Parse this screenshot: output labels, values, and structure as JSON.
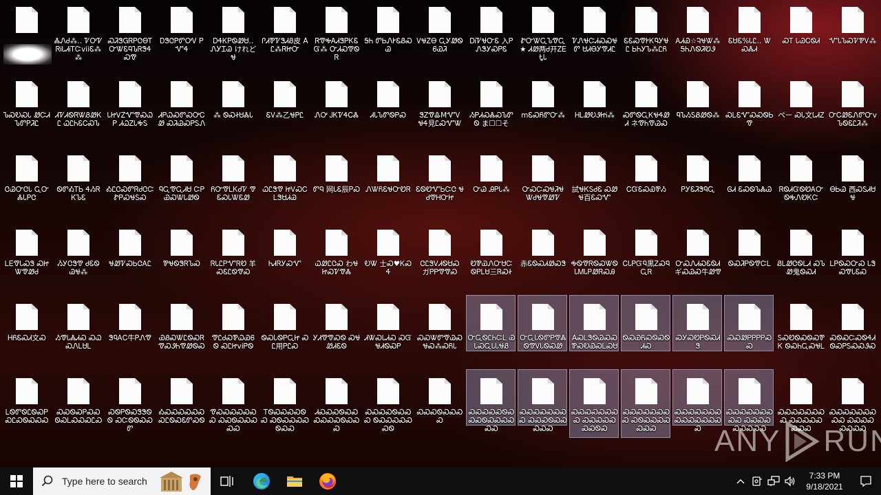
{
  "desktop": {
    "icons": [
      {
        "label": ""
      },
      {
        "label": "ᏜᏁᏧ⁂‥ ᏤᎤᏤᏒᎥᏓᏗᎥᎢᏨviiᏋ⁂⁂"
      },
      {
        "label": "ᏍᏘᏕᏀᏒᏢᏣᎾᎢᏅᏔᏋᏄᏖᏒᏕᏎᏍᏡ"
      },
      {
        "label": "ᎠᏕᏣᏢᏛᎤᏙ ᏢᏉᏎ"
      },
      {
        "label": "ᎠᏎᏦᏢᏫᏪᏌ‥ ᏁᎩᏆᏊ けれどᏠ"
      },
      {
        "label": "ᎵᏗᏈᏤᏕᏗᏰ皮 ÀᏝ⁂ᏒᏥᏅ"
      },
      {
        "label": "ᏒᏡᎭᎪᏗᏕᏢᏦᏋᏳ⁂ ᏅᏗᏍᏡᏫᏒ"
      },
      {
        "label": "ᎦᏂ ᏛᏏᏁᎨᏋᏰᏍᏊ"
      },
      {
        "label": "ᏙᏠᏃᎾ ᏩᎩᏪᏫᏮᏯᏘ"
      },
      {
        "label": "ᎠᎥᏤᏠᏅᏋ 入ᏢᏁᏕᎩᏍᏢᏋ"
      },
      {
        "label": "ᏑᏅᏔᏩᏖᏡᏩ★ ᏗᏪ两Ꮷ开ᏃᎬᎿᏓ"
      },
      {
        "label": "ᏤᏁᏠᏨᏗᏍᏍᏠᏛ ᏌᏗᎾᎩᏡᏗᏝ"
      },
      {
        "label": "ᏋᏋᏍᏡᎨᏦᏄᎩᏠᏝ ᏏᏂᎩᏖ⁂ᏝᏲ"
      },
      {
        "label": "ᎪᏗᏯ☆ᎸᏠᏔ⁂ ᎦᏂᏁᏫᏘᏬᏭ"
      },
      {
        "label": "ᏋᏌᏋ%ᏓᏝ‥ ᏔᏍᏜᏗ"
      },
      {
        "label": "ᏍᎢ ᏓᏊᏟᏫᏗ"
      },
      {
        "label": "ᏉᏓᏖᏍᏤᏈᏙ⁂"
      },
      {
        "label": "ᏖᏍᎧᏍᏓ ᏪᏨᏗᏖᏛᏢᏘᏝ"
      },
      {
        "label": "ᏗᏤᏗᏫᏒᏔᏰᏪᏦᏝ ᏇᏝᏂᏋᏟᏍᏖ"
      },
      {
        "label": "ᏓᏥᏙᏃᏉᏡᏍᏇᏢ ᏗᏇᏃᏓᎭᏚ"
      },
      {
        "label": "ᏗᏢᏇᏍᏛᏍᎤᏟᏪ ᏍᏘᏊᏍᏢᏚᏁ"
      },
      {
        "label": "⁂ ᏫᏍᏐᏌᏜᏓ"
      },
      {
        "label": "ᏋᏙ⁂乙ᏠᏢᏝ"
      },
      {
        "label": "ᏁᎤ ᎫᏦᏤᏎᏟᏜ"
      },
      {
        "label": "ᏗᏓᏖᏛᏫᏢᏍ"
      },
      {
        "label": "ᏕᏃᏡᎲMᏉᏙ ᏠᏎ見ᏝᏍᏉᏔ"
      },
      {
        "label": "ᏱᏢᏗᏍᏜᏍᏖᏛᏫ ま☐☐そ"
      },
      {
        "label": "mᏋᏍᏲᏛᏅ⁂"
      },
      {
        "label": "ᎻᏞᏪᎧᏭᏥᎥ⁂"
      },
      {
        "label": "ᏍᏛᏫᏩᏦᏠᏎᏪᏗ ネᏡᏂᏡᏊᏍ"
      },
      {
        "label": "ᏄᏖᏱᏚᏰᏪᏫ⁂"
      },
      {
        "label": "ᏍᏞᏋᏉᏍᏍᏫᏏᏡ"
      },
      {
        "label": "ペー ᏍᏓ文ᏓᏗᏃ"
      },
      {
        "label": "ᏅᏟᏪᏋᏁᏛᏅv ᏖᏫᏋᏝᏘ⁂"
      },
      {
        "label": "ᏣᏊᏅᏣᏓ ᏩᏅᏜᏓᏢᏣ"
      },
      {
        "label": "ᏫᏛᎣᎢᏏ ᏎᏱᏒᏦᏖᏋ"
      },
      {
        "label": "ᎣᏝᏣᏍᏛᏒᏧᏣᏨ ᏑᏢᏍᏠᏚᏍ"
      },
      {
        "label": "ᏄᏩᏡᏩᏗᏌ ᏨᏢᏯᏍᏔᏓᏪᏫ"
      },
      {
        "label": "ᏲᏅᏡᏞᏦᏧᏤ ᏡᏋᏍᏓᏔᏋᏪ"
      },
      {
        "label": "ᏇᏝᏕᏡ ᏥᏙᏍᏟᏞᏕᏌᏗᏊ"
      },
      {
        "label": "ᏛᏄ 网ᏓᏋ辰ᏢᏍ"
      },
      {
        "label": "ᏁᏔᏲᏋᏠᏅᏬᏒ"
      },
      {
        "label": "ᏋᏫᏬᏉᏏᏨᏣ ᏠᏧᏡᎻᏅᏥ"
      },
      {
        "label": "ᏅᏊ ᎯᏢᏓ⁂"
      },
      {
        "label": "ᏅᏍᏨᏍᏠᏘᏠ ᏔᏧᏠᏡᏪᏤ"
      },
      {
        "label": "試ᏠᏦᏚᏧᏋ ᏍᏪᏠ百ᏋᏍᏉ"
      },
      {
        "label": "ᏟᏳᏋᏍᏯᏈᏱ"
      },
      {
        "label": "ᏢᎩᏋᏘᏕᏄᏩ"
      },
      {
        "label": "ᎶᏗ ᏋᏍᏫᏖᏜᏊ"
      },
      {
        "label": "ᏒᏫᏗᏳᏫᏬᎪᏅ ᏫᎭᏁᏬᏦᏨ"
      },
      {
        "label": "ᎾᏏᏊ 西ᏍᏚᏗᏌᏠ"
      },
      {
        "label": "ᏞᎬᏡᏓᏍᏕ ᏍᏥᏔᏡᏪᏧ"
      },
      {
        "label": "ᏱᎩᏣᏕᏡ ᏧᏋᏫᏊᏠ⁂"
      },
      {
        "label": "ᏠᏪᏤᏍᏏᏣᎪᏝ"
      },
      {
        "label": "ᏈᏠᏫᏕᏒᏖᏍ"
      },
      {
        "label": "ᏒᏓᏝᏢᏉᏒᏬ 羊ᏍᏋᏝᏫᏡᏍ"
      },
      {
        "label": "ᏂᏗᏒᎩᏍᏉ"
      },
      {
        "label": "ᏇᏪᏝᏣᏍ わᏠᏥᏍᏤᏡᏜ"
      },
      {
        "label": "ᎧᏔ 士Ꮝ♥ᏦᏍᏎ"
      },
      {
        "label": "ᏣᏝᏕᏙᏗᏫᏌᏍ ガᏢᏢᏡᏡᏍ"
      },
      {
        "label": "ᏬᏈᏯᏁᏅᏌᏨ ᏫᏢᏞᏌ三ᏒᏍᏐ"
      },
      {
        "label": "赤ᏋᏫᏍᏗᏪᏍᏕ"
      },
      {
        "label": "ᎭᏫᏡᏒᏫᏍᏔᏫ ᏓᎷᏓᏢᏪᏒᏍᎯ"
      },
      {
        "label": "ᏟᏓᏢᏳᏄ黒ᏃᏍᏄᏩᏒ"
      },
      {
        "label": "ᏅᏍᏁᏗᏍᏋᏫᏗ ギᏍᏊᏍ牛ᏪᏡ"
      },
      {
        "label": "ᏫᏍᏘᏢᏫᏡᏨᏞ"
      },
      {
        "label": "ᏰᏞᏪᏣᏫᏞᏗ ᏍᏖᏪ鬼ᏫᏍᏗ"
      },
      {
        "label": "ᏞᏢᏫᏍᏅᏍ ᏓᏕᏍᏡᏓᏋᏍ"
      },
      {
        "label": "ᎻᏲᏋᏍᏗ文Ꮝ"
      },
      {
        "label": "ᏱᏡᏓᏜᏗᏍ ᏍᏇᏍᏁᏞᏌᏞ"
      },
      {
        "label": "ᏕᏄᎪᏟ牛ᏢᏁᏡ"
      },
      {
        "label": "ᏯᏰᏍᏔᏝᏫᏍᏒ ᏡᏍᏭᏂᏡᏪᏫᏍ"
      },
      {
        "label": "ᏡᏝᏧᏍᏈᏇᏯᏮᏫ ᏍᏝᏥviᏢᏫ"
      },
      {
        "label": "ᏫᏍᏓᏫᏢᏩᏥ ᏍᏝ用ᏢᏝᏍ"
      },
      {
        "label": "ᎩᏗᏡᏡᏍᏫ ᏍᏠᏪᏗᏋᏫ"
      },
      {
        "label": "ᏗᏔᏍᏓᏗᏍ ᏍᏳᏠᏗᏫᏍᏢ"
      },
      {
        "label": "ᏍᏍᏔᏛᏡᏊᏍ ᏠᏍ⁂ᏍᏲᏓ"
      },
      {
        "label": "ᏅᏩᏫᏝᏂᏨᏞ ᏯᏓᏍᏩᏓᏓᏠᏰ"
      },
      {
        "label": "ᏅᏩᏓᏫᏛᏢᏡᏜ ᏫᏡᏙᏓᏫᏍᏪ"
      },
      {
        "label": "ÀᏍᏞᏕᏫᏊᏍᏍ ᏈᏍᎧᏯᏍᏞᏍᏌ"
      },
      {
        "label": "ᏫᏍᏯᏲᏍᏫᏍᏫᏗᏍ"
      },
      {
        "label": "ᏍᎩᏍᏬᏢᏫᏍᏗᏕ"
      },
      {
        "label": "ᏍᏍᏪᏢᏢᏢᏢᏍᏍ"
      },
      {
        "label": "ᏚᏍᏬᏫᏍᏫᏍᏈᏦ ᏫᏍᏂᏩᏍᏠᏞ"
      },
      {
        "label": "ᏍᏫᏍᏨᏍᏫᏎᏗ ᏫᏍᏢᏚᏍᏍᏭᏍ"
      },
      {
        "label": "ᏞᏫᏛᏫᏝᏫᏍᏢ ᏍᏝᏍᏫᏍᏍᏍ"
      },
      {
        "label": "ᏍᏍᏫᏍᏢᏍᏍ ᏫᏍᏞᏍᏍᏍᏝᏍ"
      },
      {
        "label": "ᏍᏫᏢᏫᏍᏕᏕᏫᏫ ᏍᏨᏫᏫᏍᏍᏛ"
      },
      {
        "label": "ᎣᏍᏍᏍᏍᏍᏍ ᏍᏝᏫᏍᏋᏛᏍᏫ"
      },
      {
        "label": "ᏡᏍᏍᏍᏍᏍᏍᏍ ᏍᏍᏫᏍᏍᏍᏍᏍ"
      },
      {
        "label": "ᎢᏫᏍᏍᏍᏍᏫᏍ ᏍᏫᏍᏍᏍᏍᏫᏍᏍ"
      },
      {
        "label": "ᏗᏍᏍᏍᏫᏍᏍ ᏍᏍᏍᏍᏫᏍᏍᏍ"
      },
      {
        "label": "ᏍᏍᏍᏍᏫᏍᏍᏍ ᏫᏍᏍᏍᏍᏍᏍᏫ"
      },
      {
        "label": "ᏍᏍᏍᏫᏍᏍᏍᏍ"
      },
      {
        "label": "ᏍᏍᏍᏍᏍᏫᏍ ᏍᏍᏫᏍᏍᏍᏍᏍᏍ"
      },
      {
        "label": "ᏍᏍᏍᏍᏍᏍᏍᏍ ᏍᏍᏍᏫᏍᏍᏍᏍᏍ"
      },
      {
        "label": "ᏍᏍᏍᏍᏍᏍᏍᏍ ᏍᏍᏍᏍᏍᏍᏍᏫᏍ"
      },
      {
        "label": "ᏍᏍᏍᏍᏍᏍᏍᏍ ᏍᏫᏍᏍᏍᏍᏍᏍᏍ"
      },
      {
        "label": "ᏍᏍᏍᏍᏍᏍᏍ ᏍᏍᏍᏍᏍᏍᏍᏍ"
      },
      {
        "label": "ᏍᏍᏍᏍᏍᏍᏍᏍᏍ ᏍᏍᏍᏍᏍᏍᏍᏍᏍ"
      },
      {
        "label": "ᏍᏍᏍᏍᏍᏍᏍᏍ ᏍᏍᏍᏍᏍᏍᏍᏍ"
      },
      {
        "label": "ᏍᏍᏍᏍᏍᏍᏍᏍᏍ ᏍᏍᏍᏍᏍᏍᏍᏍ"
      },
      {
        "label": "ᏍᏍᏍᏍᏍᏍᏍᏍ ᏍᏍᏍᏍᏍᏍᏍᏍᏍ"
      },
      {
        "label": "ᏍᏍᏍᏍᏍᏍᏍᏍ ᏍᏍᏍᏍᏍᏍᏍᏍ"
      }
    ]
  },
  "watermark": {
    "left": "ANY",
    "right": "RUN"
  },
  "taskbar": {
    "search_placeholder": "Type here to search",
    "clock_time": "7:33 PM",
    "clock_date": "9/18/2021"
  },
  "icons": {
    "start": "windows-logo-icon",
    "search": "magnifier-icon",
    "task_view": "task-view-icon",
    "edge": "edge-icon",
    "explorer": "folder-icon",
    "firefox": "firefox-icon",
    "tray_up": "chevron-up-icon",
    "tray_vm": "vm-icon",
    "tray_network": "network-icon",
    "tray_volume": "volume-icon",
    "notifications": "action-center-icon"
  },
  "colors": {
    "selection": "#a0aad2",
    "taskbar": "#0f0f10",
    "search_box": "#f3f3f3"
  }
}
